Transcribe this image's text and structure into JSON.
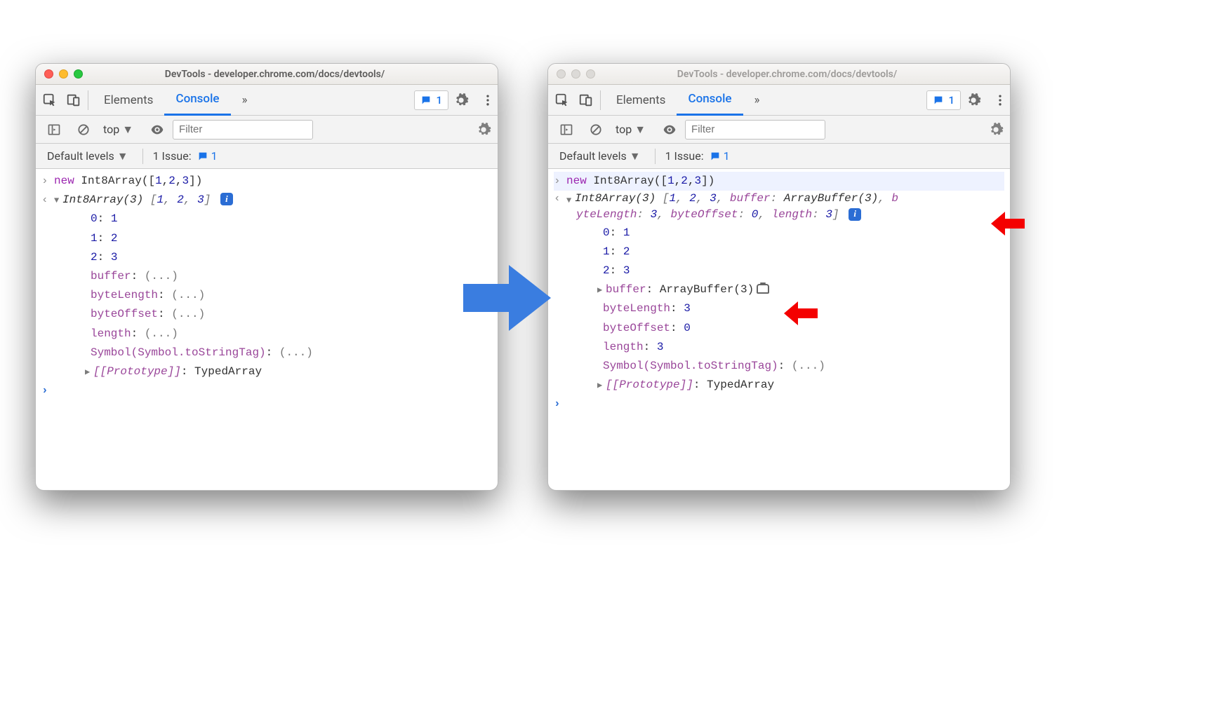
{
  "window_title": "DevTools - developer.chrome.com/docs/devtools/",
  "tabs": {
    "elements": "Elements",
    "console": "Console",
    "more": "»"
  },
  "issues_count": "1",
  "filter_placeholder": "Filter",
  "context": "top",
  "levels_label": "Default levels",
  "issues_label": "1 Issue:",
  "issues_badge": "1",
  "input_code": "new Int8Array([1,2,3])",
  "left": {
    "header": "Int8Array(3) [1, 2, 3]",
    "indices": [
      {
        "key": "0",
        "value": "1"
      },
      {
        "key": "1",
        "value": "2"
      },
      {
        "key": "2",
        "value": "3"
      }
    ],
    "props": [
      {
        "key": "buffer",
        "value": "(...)"
      },
      {
        "key": "byteLength",
        "value": "(...)"
      },
      {
        "key": "byteOffset",
        "value": "(...)"
      },
      {
        "key": "length",
        "value": "(...)"
      },
      {
        "key": "Symbol(Symbol.toStringTag)",
        "value": "(...)"
      }
    ],
    "proto": {
      "label": "[[Prototype]]",
      "value": "TypedArray"
    }
  },
  "right": {
    "header_line1": "Int8Array(3) [1, 2, 3, buffer: ArrayBuffer(3), b",
    "header_line2": "yteLength: 3, byteOffset: 0, length: 3]",
    "indices": [
      {
        "key": "0",
        "value": "1"
      },
      {
        "key": "1",
        "value": "2"
      },
      {
        "key": "2",
        "value": "3"
      }
    ],
    "buffer": {
      "key": "buffer",
      "value": "ArrayBuffer(3)"
    },
    "props": [
      {
        "key": "byteLength",
        "value": "3"
      },
      {
        "key": "byteOffset",
        "value": "0"
      },
      {
        "key": "length",
        "value": "3"
      },
      {
        "key": "Symbol(Symbol.toStringTag)",
        "value": "(...)"
      }
    ],
    "proto": {
      "label": "[[Prototype]]",
      "value": "TypedArray"
    }
  }
}
